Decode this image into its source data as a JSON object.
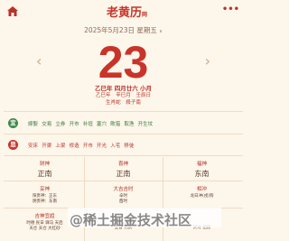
{
  "header": {
    "logo_main": "老黄历",
    "logo_suffix": "网",
    "more_label": "•••"
  },
  "date": {
    "solar": "2025年5月23日 星期五",
    "weekday_toggle": "∨",
    "day": "23"
  },
  "nav": {
    "prev": "‹",
    "next": "›"
  },
  "lunar": {
    "text": "乙巳年 四月廿六 小月"
  },
  "ganzhi": {
    "year": "乙巳年",
    "month": "辛巳月",
    "day": "壬辰日"
  },
  "zodiac": {
    "a": "生肖蛇",
    "b": "殺子南"
  },
  "yi": {
    "badge": "宜",
    "items": [
      "嫁娶",
      "交易",
      "立券",
      "开市",
      "补垣",
      "塞穴",
      "畋猎",
      "取渔",
      "开生坟"
    ]
  },
  "ji": {
    "badge": "忌",
    "items": [
      "安床",
      "开渠",
      "上梁",
      "修造",
      "开市",
      "开光",
      "入宅",
      "移徙"
    ]
  },
  "gods_row1": [
    {
      "title": "财神",
      "value": "正南"
    },
    {
      "title": "喜神",
      "value": "正南"
    },
    {
      "title": "福神",
      "value": "东南"
    }
  ],
  "gods_row2": [
    {
      "title": "妥神",
      "line1": "阳贵神：正东",
      "line2": "阴贵神：东南"
    },
    {
      "title": "大吉吉时",
      "line1": "辛时",
      "line2": "酉时"
    },
    {
      "title": "相冲",
      "line1": "龙日冲(戌)狗",
      "line2": ""
    }
  ],
  "gods_row3": [
    {
      "title": "吉神宜趋",
      "line1": "时德 民日 驿马 天后",
      "line2": "天仓 天仓 大红砂"
    },
    {
      "title": "",
      "line1": "五虚 土府",
      "line2": "五官 元武"
    },
    {
      "title": "",
      "line1": "",
      "line2": "厌对 招摇"
    }
  ],
  "watermark": {
    "text": "@稀土掘金技术社区"
  },
  "colors": {
    "accent": "#c8342a",
    "good": "#3a8a4a",
    "bg": "#fdf6ea"
  }
}
